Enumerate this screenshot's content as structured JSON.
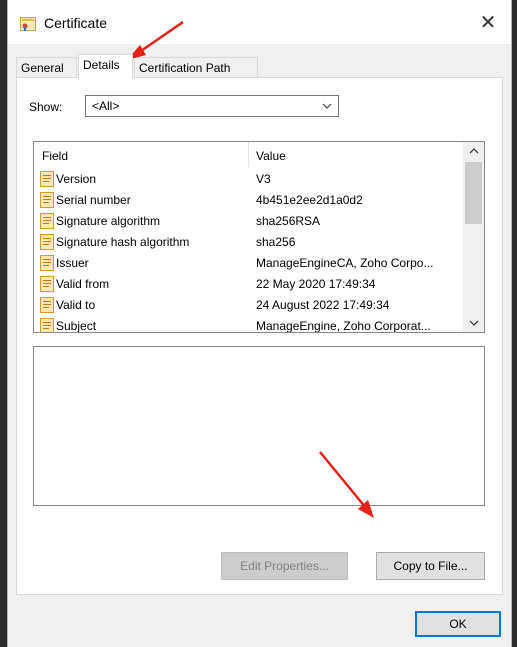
{
  "window": {
    "title": "Certificate",
    "close_glyph": "✕"
  },
  "tabs": [
    {
      "label": "General"
    },
    {
      "label": "Details"
    },
    {
      "label": "Certification Path"
    }
  ],
  "show": {
    "label": "Show:",
    "value": "<All>"
  },
  "list": {
    "header_field": "Field",
    "header_value": "Value",
    "rows": [
      {
        "field": "Version",
        "value": "V3"
      },
      {
        "field": "Serial number",
        "value": "4b451e2ee2d1a0d2"
      },
      {
        "field": "Signature algorithm",
        "value": "sha256RSA"
      },
      {
        "field": "Signature hash algorithm",
        "value": "sha256"
      },
      {
        "field": "Issuer",
        "value": "ManageEngineCA, Zoho Corpo..."
      },
      {
        "field": "Valid from",
        "value": "22 May 2020 17:49:34"
      },
      {
        "field": "Valid to",
        "value": "24 August 2022 17:49:34"
      },
      {
        "field": "Subject",
        "value": "ManageEngine, Zoho Corporat..."
      }
    ]
  },
  "buttons": {
    "edit_properties": "Edit Properties...",
    "copy_to_file": "Copy to File...",
    "ok": "OK"
  },
  "colors": {
    "annotation_arrow": "#e8201a",
    "accent": "#0078d7"
  },
  "icons": {
    "title": "certificate-icon",
    "field": "certificate-field-icon",
    "close": "close-icon",
    "dropdown": "chevron-down-icon"
  }
}
